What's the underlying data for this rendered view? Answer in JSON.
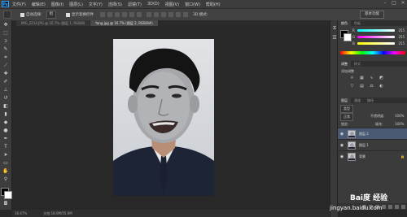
{
  "app": {
    "logo": "Ps"
  },
  "menu": [
    "文件(F)",
    "编辑(E)",
    "图像(I)",
    "图层(L)",
    "文字(Y)",
    "选择(S)",
    "滤镜(T)",
    "3D(D)",
    "视图(V)",
    "窗口(W)",
    "帮助(H)"
  ],
  "options_bar": {
    "auto_select_label": "自动选择:",
    "auto_select_value": "组",
    "show_transform_label": "显示变换控件",
    "workspace": "基本功能"
  },
  "tabs": [
    {
      "label": "IMG_2214.JPG @ 16.7% (图层 1, RGB/8)",
      "active": false
    },
    {
      "label": "fang.jpg @ 16.7% (图层 2, RGB/8#)",
      "active": true
    }
  ],
  "status": {
    "zoom": "16.67%",
    "doc": "文档:18.0M/55.6M"
  },
  "color_panel": {
    "tabs": [
      "颜色",
      "色板"
    ],
    "r_label": "R",
    "g_label": "G",
    "b_label": "B",
    "r_value": "255",
    "g_value": "255",
    "b_value": "255",
    "fg_color": "#000000",
    "bg_color": "#ffffff"
  },
  "adjust_panel": {
    "tabs": [
      "调整",
      "样式"
    ],
    "hint": "添加调整"
  },
  "layers_panel": {
    "tabs": [
      "图层",
      "通道",
      "路径"
    ],
    "kind_label": "类型",
    "blend_mode": "正常",
    "opacity_label": "不透明度:",
    "opacity": "100%",
    "lock_label": "锁定:",
    "fill_label": "填充:",
    "fill": "100%",
    "layers": [
      {
        "name": "图层 2",
        "selected": true
      },
      {
        "name": "图层 1",
        "selected": false
      },
      {
        "name": "背景",
        "selected": false
      }
    ]
  },
  "watermark": {
    "brand": "Bai度 经验",
    "url": "jingyan.baidu.com"
  }
}
